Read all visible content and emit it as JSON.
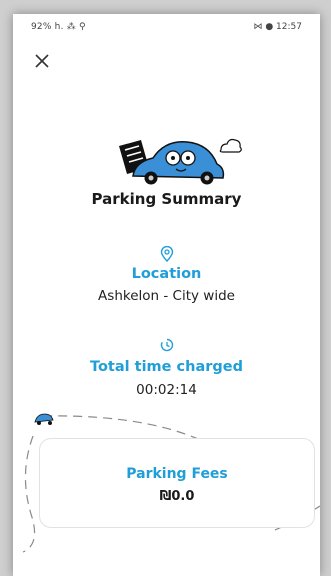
{
  "status_bar": {
    "left": "92% h. ⁂ ⚲",
    "right": "⋈ ● 12:57"
  },
  "header": {
    "close_icon": "close-icon"
  },
  "summary": {
    "title": "Parking Summary",
    "location": {
      "icon": "location-pin-icon",
      "heading": "Location",
      "value": "Ashkelon - City wide"
    },
    "time": {
      "icon": "timer-icon",
      "heading": "Total time charged",
      "value": "00:02:14"
    }
  },
  "fees": {
    "heading": "Parking Fees",
    "value": "₪0.0"
  },
  "colors": {
    "accent": "#1f9ed8",
    "car": "#3a8fd6",
    "text": "#1a1a1a"
  }
}
